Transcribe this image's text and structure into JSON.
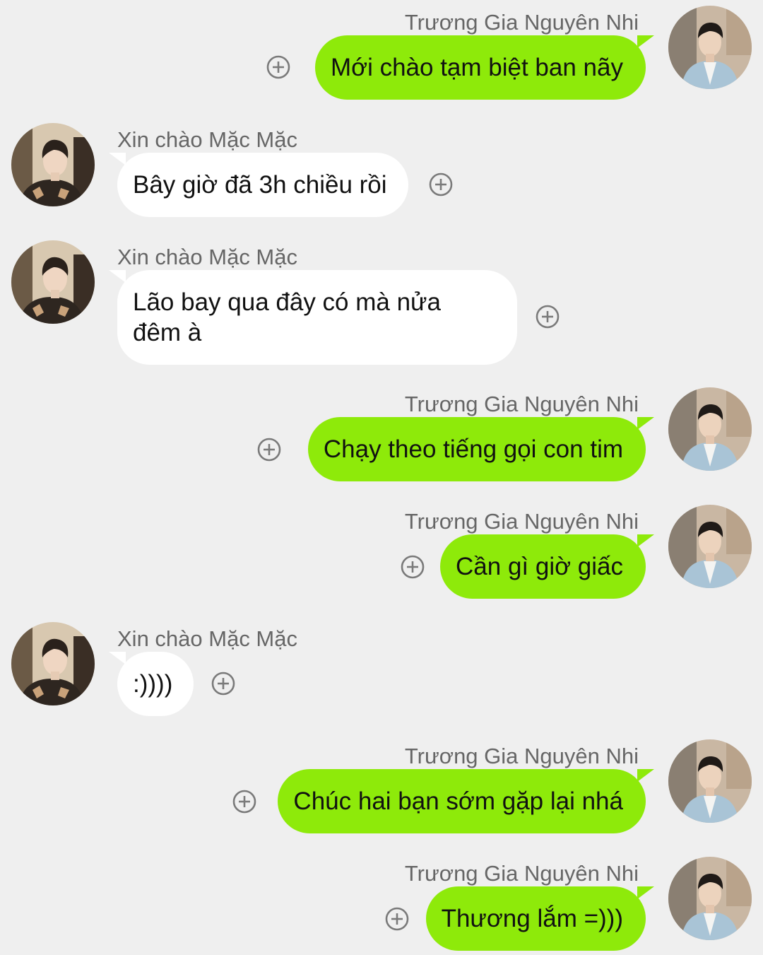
{
  "app": {
    "accent_out": "#8eea0a",
    "bubble_in": "#ffffff",
    "background": "#efefef"
  },
  "messages": [
    {
      "direction": "out",
      "sender": "Trương Gia Nguyên Nhi",
      "text": "Mới chào tạm biệt ban nãy",
      "icon": "add-circle-icon"
    },
    {
      "direction": "in",
      "sender": "Xin chào Mặc Mặc",
      "text": "Bây giờ đã 3h chiều rồi",
      "icon": "add-circle-icon"
    },
    {
      "direction": "in",
      "sender": "Xin chào Mặc Mặc",
      "text": "Lão bay qua đây có mà nửa đêm à",
      "icon": "add-circle-icon"
    },
    {
      "direction": "out",
      "sender": "Trương Gia Nguyên Nhi",
      "text": "Chạy theo tiếng gọi con tim",
      "icon": "add-circle-icon"
    },
    {
      "direction": "out",
      "sender": "Trương Gia Nguyên Nhi",
      "text": "Cần gì giờ giấc",
      "icon": "add-circle-icon"
    },
    {
      "direction": "in",
      "sender": "Xin chào Mặc Mặc",
      "text": ":))))",
      "icon": "add-circle-icon"
    },
    {
      "direction": "out",
      "sender": "Trương Gia Nguyên Nhi",
      "text": "Chúc hai bạn sớm gặp lại nhá",
      "icon": "add-circle-icon"
    },
    {
      "direction": "out",
      "sender": "Trương Gia Nguyên Nhi",
      "text": "Thương lắm =)))",
      "icon": "add-circle-icon"
    }
  ]
}
